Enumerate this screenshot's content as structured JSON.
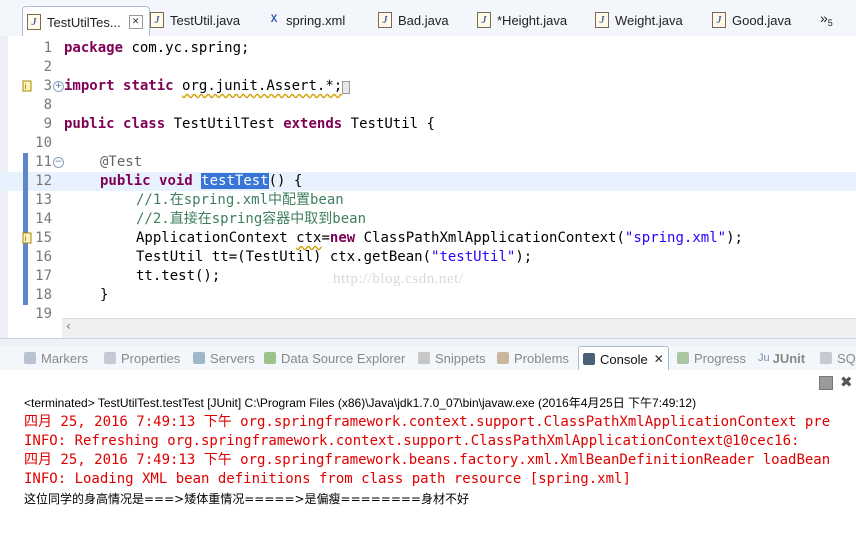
{
  "editor_tabs": [
    {
      "label": "TestUtilTes...",
      "icon": "java-file-icon",
      "active": true
    },
    {
      "label": "TestUtil.java",
      "icon": "java-file-icon"
    },
    {
      "label": "spring.xml",
      "icon": "xml-file-icon"
    },
    {
      "label": "Bad.java",
      "icon": "java-file-icon"
    },
    {
      "label": "*Height.java",
      "icon": "java-file-icon"
    },
    {
      "label": "Weight.java",
      "icon": "java-file-icon"
    },
    {
      "label": "Good.java",
      "icon": "java-file-icon"
    }
  ],
  "overflow": {
    "symbol": "»",
    "count": "5"
  },
  "code_lines": [
    {
      "num": "1",
      "text": "package com.yc.spring;"
    },
    {
      "num": "2",
      "text": ""
    },
    {
      "num": "3",
      "text": "import static org.junit.Assert.*;"
    },
    {
      "num": "8",
      "text": ""
    },
    {
      "num": "9",
      "text": "public class TestUtilTest extends TestUtil {"
    },
    {
      "num": "10",
      "text": ""
    },
    {
      "num": "11",
      "text": "@Test"
    },
    {
      "num": "12",
      "text": "public void testTest() {"
    },
    {
      "num": "13",
      "text": "//1.在spring.xml中配置bean"
    },
    {
      "num": "14",
      "text": "//2.直接在spring容器中取到bean"
    },
    {
      "num": "15",
      "text": "ApplicationContext ctx=new ClassPathXmlApplicationContext(\"spring.xml\");"
    },
    {
      "num": "16",
      "text": "TestUtil tt=(TestUtil) ctx.getBean(\"testUtil\");"
    },
    {
      "num": "17",
      "text": "tt.test();"
    },
    {
      "num": "18",
      "text": "}"
    },
    {
      "num": "19",
      "text": ""
    }
  ],
  "tokens": {
    "package": "package",
    "pkg": "com.yc.spring;",
    "import": "import",
    "static": "static",
    "imp_path": "org.junit.Assert.*;",
    "public": "public",
    "class": "class",
    "cls": "TestUtilTest",
    "extends": "extends",
    "sup": "TestUtil {",
    "ann": "@Test",
    "void": "void",
    "method": "testTest",
    "msig": "() {",
    "cm1": "//1.在spring.xml中配置bean",
    "cm2": "//2.直接在spring容器中取到bean",
    "l15a": "ApplicationContext ",
    "ctx": "ctx",
    "eq": "=",
    "new": "new",
    "l15b": " ClassPathXmlApplicationContext(",
    "s15": "\"spring.xml\"",
    "l15c": ");",
    "l16a": "TestUtil tt=(TestUtil) ctx.getBean(",
    "s16": "\"testUtil\"",
    "l16b": ");",
    "l17": "tt.test();",
    "l18": "}"
  },
  "watermark": "http://blog.csdn.net/",
  "view_tabs": [
    {
      "label": "Markers"
    },
    {
      "label": "Properties"
    },
    {
      "label": "Servers"
    },
    {
      "label": "Data Source Explorer"
    },
    {
      "label": "Snippets"
    },
    {
      "label": "Problems"
    },
    {
      "label": "Console",
      "active": true
    },
    {
      "label": "Progress"
    },
    {
      "label": "JUnit"
    },
    {
      "label": "SQL"
    }
  ],
  "console": {
    "terminated": "<terminated> TestUtilTest.testTest [JUnit] C:\\Program Files (x86)\\Java\\jdk1.7.0_07\\bin\\javaw.exe (2016年4月25日 下午7:49:12)",
    "lines": [
      "四月 25, 2016 7:49:13 下午 org.springframework.context.support.ClassPathXmlApplicationContext pre",
      "INFO: Refreshing org.springframework.context.support.ClassPathXmlApplicationContext@10cec16:",
      "四月 25, 2016 7:49:13 下午 org.springframework.beans.factory.xml.XmlBeanDefinitionReader loadBean",
      "INFO: Loading XML bean definitions from class path resource [spring.xml]"
    ],
    "output": "这位同学的身高情况是===>矮体重情况=====>是偏瘦========身材不好"
  },
  "colors": {
    "keyword": "#7f0055",
    "comment": "#3f7f5f",
    "string": "#2a00ff",
    "stderr": "#e00000",
    "selection": "#3875d7"
  }
}
